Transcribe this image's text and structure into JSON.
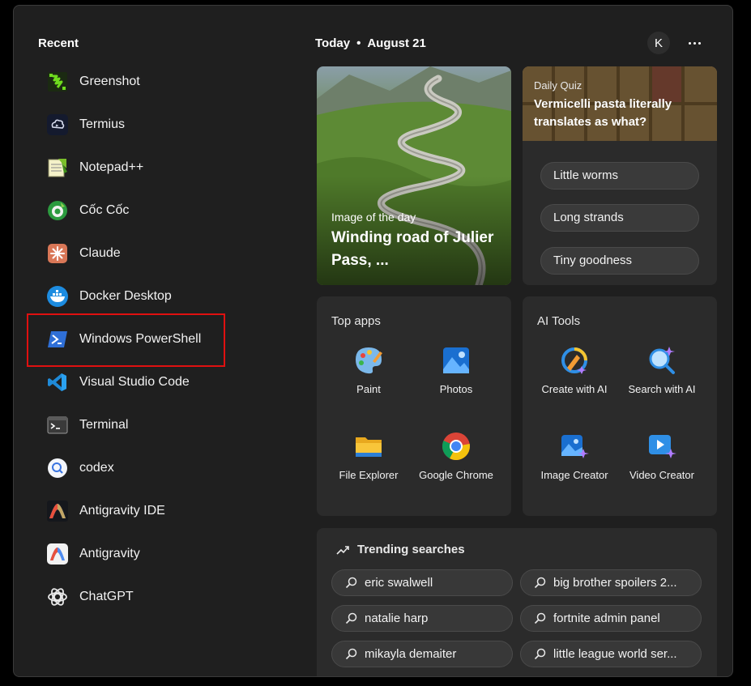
{
  "recent": {
    "title": "Recent",
    "items": [
      {
        "label": "Greenshot",
        "icon": "greenshot-icon"
      },
      {
        "label": "Termius",
        "icon": "termius-icon"
      },
      {
        "label": "Notepad++",
        "icon": "notepadpp-icon"
      },
      {
        "label": "Cốc Cốc",
        "icon": "coccoc-icon"
      },
      {
        "label": "Claude",
        "icon": "claude-icon"
      },
      {
        "label": "Docker Desktop",
        "icon": "docker-icon"
      },
      {
        "label": "Windows PowerShell",
        "icon": "powershell-icon"
      },
      {
        "label": "Visual Studio Code",
        "icon": "vscode-icon"
      },
      {
        "label": "Terminal",
        "icon": "terminal-icon"
      },
      {
        "label": "codex",
        "icon": "codex-icon"
      },
      {
        "label": "Antigravity IDE",
        "icon": "antigravity-ide-icon"
      },
      {
        "label": "Antigravity",
        "icon": "antigravity-icon"
      },
      {
        "label": "ChatGPT",
        "icon": "chatgpt-icon"
      }
    ]
  },
  "header": {
    "today": "Today",
    "separator": "•",
    "date": "August 21",
    "avatar": "K"
  },
  "image_of_day": {
    "kicker": "Image of the day",
    "title": "Winding road of Julier Pass, ..."
  },
  "quiz": {
    "kicker": "Daily Quiz",
    "question": "Vermicelli pasta literally translates as what?",
    "options": [
      "Little worms",
      "Long strands",
      "Tiny goodness"
    ]
  },
  "top_apps": {
    "title": "Top apps",
    "apps": [
      {
        "label": "Paint",
        "icon": "paint-icon"
      },
      {
        "label": "Photos",
        "icon": "photos-icon"
      },
      {
        "label": "File Explorer",
        "icon": "file-explorer-icon"
      },
      {
        "label": "Google Chrome",
        "icon": "chrome-icon"
      }
    ]
  },
  "ai_tools": {
    "title": "AI Tools",
    "apps": [
      {
        "label": "Create with AI",
        "icon": "create-ai-icon"
      },
      {
        "label": "Search with AI",
        "icon": "search-ai-icon"
      },
      {
        "label": "Image Creator",
        "icon": "image-creator-icon"
      },
      {
        "label": "Video Creator",
        "icon": "video-creator-icon"
      }
    ]
  },
  "trending": {
    "title": "Trending searches",
    "searches": [
      "eric swalwell",
      "big brother spoilers 2...",
      "natalie harp",
      "fortnite admin panel",
      "mikayla demaiter",
      "little league world ser..."
    ]
  },
  "colors": {
    "panel": "#1f1f1f",
    "card": "#2b2b2b",
    "highlight": "#e01010"
  }
}
